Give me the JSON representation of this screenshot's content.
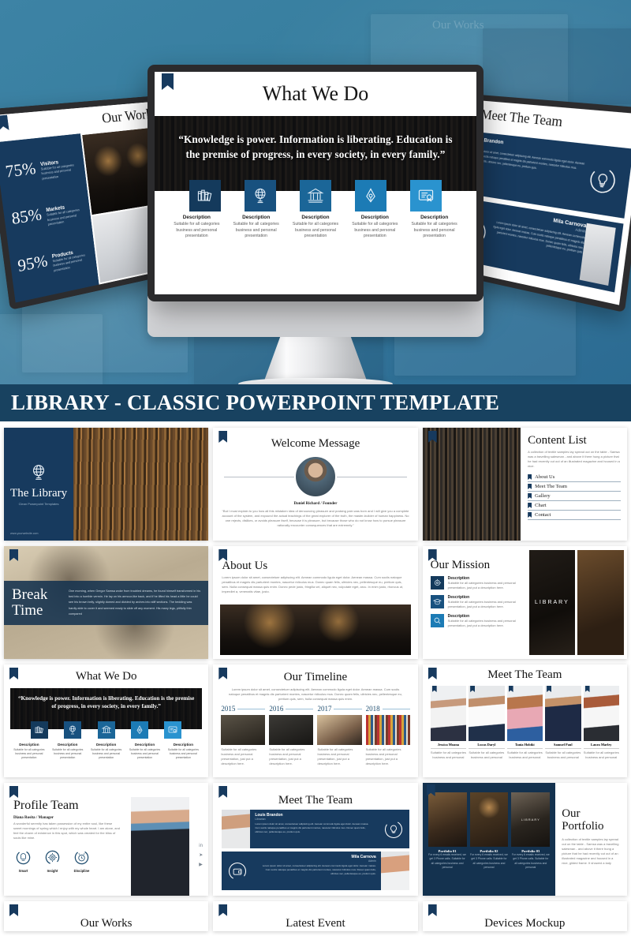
{
  "banner": {
    "title": "LIBRARY - CLASSIC POWERPOINT TEMPLATE",
    "bg_color": "#184260"
  },
  "hero": {
    "background_color": "#35789c",
    "center_monitor": {
      "slide_title": "What We Do",
      "quote": "“Knowledge is power. Information is liberating. Education is the premise of progress, in every society, in every family.”",
      "features": [
        {
          "icon": "books-icon",
          "title": "Description",
          "desc": "Suitable for all categories business and personal presentation",
          "color": "#143a5c"
        },
        {
          "icon": "globe-icon",
          "title": "Description",
          "desc": "Suitable for all categories business and personal presentation",
          "color": "#18517f"
        },
        {
          "icon": "bank-icon",
          "title": "Description",
          "desc": "Suitable for all categories business and personal presentation",
          "color": "#1b6698"
        },
        {
          "icon": "pen-nib-icon",
          "title": "Description",
          "desc": "Suitable for all categories business and personal presentation",
          "color": "#1c7bb5"
        },
        {
          "icon": "certificate-icon",
          "title": "Description",
          "desc": "Suitable for all categories business and personal presentation",
          "color": "#2a93cf"
        }
      ]
    },
    "left_monitor": {
      "slide_title": "Our Works",
      "stats": [
        {
          "value": "75%",
          "label": "Visitors",
          "desc": "Suitable for all categories business and personal presentation"
        },
        {
          "value": "85%",
          "label": "Markets",
          "desc": "Suitable for all categories business and personal presentation"
        },
        {
          "value": "95%",
          "label": "Products",
          "desc": "Suitable for all categories business and personal presentation"
        }
      ]
    },
    "right_monitor": {
      "slide_title": "Meet The Team",
      "members": [
        {
          "name": "Louis Brandon",
          "role": "Librarian",
          "desc": "Lorem ipsum dolor sit amet, consectetuer adipiscing elit. Aenean commodo ligula eget dolor. Aenean massa. Cum sociis natoque penatibus et magnis dis parturient montes, nascetur ridiculus mus. Donec quam felis, ultricies nec, pellentesque eu, pretium quis.",
          "icon": "lightbulb-icon"
        },
        {
          "name": "Mila Carnova",
          "role": "Admin",
          "desc": "Lorem ipsum dolor sit amet, consectetuer adipiscing elit. Aenean commodo ligula eget dolor. Aenean massa. Cum sociis natoque penatibus et magnis dis parturient montes, nascetur ridiculus mus. Donec quam felis, ultricies nec, pellentesque eu, pretium quis.",
          "icon": "wallet-icon"
        }
      ]
    }
  },
  "slides": [
    {
      "id": "cover",
      "title": "The Library",
      "subtitle": "Clean Powerpoint Templates",
      "website": "www.yourwebsite.com",
      "icon": "globe-icon"
    },
    {
      "id": "welcome",
      "title": "Welcome Message",
      "person": "Daniel Richard / Founder",
      "body": "“But I must explain to you how all this mistaken idea of denouncing pleasure and praising pain was born and I will give you a complete account of the system, and expound the actual teachings of the great explorer of the truth, the master-builder of human happiness. No one rejects, dislikes, or avoids pleasure itself, because it is pleasure, but because those who do not know how to pursue pleasure rationally encounter consequences that are extremely.”"
    },
    {
      "id": "content-list",
      "title": "Content List",
      "body": "A collection of textile samples lay spread out on the table - Samsa was a travelling salesman - and above it there hung a picture that he had recently cut out of an illustrated magazine and housed in a nice.",
      "items": [
        "About Us",
        "Meet The Team",
        "Gallery",
        "Chart",
        "Contact"
      ]
    },
    {
      "id": "break-time",
      "title": "Break Time",
      "body": "One morning, when Gregor Samsa woke from troubled dreams, he found himself transformed in his bed into a horrible vermin. He lay on his armour-like back, and if he lifted his head a little he could see his brown belly, slightly domed and divided by arches into stiff sections. The bedding was hardly able to cover it and seemed ready to slide off any moment. His many legs, pitifully thin compared"
    },
    {
      "id": "about-us",
      "title": "About Us",
      "body": "Lorem ipsum dolor sit amet, consectetuer adipiscing elit. Aenean commodo ligula eget dolor. Aenean massa. Cum sociis natoque penatibus et magnis dis parturient montes, nascetur ridiculus mus. Donec quam felis, ultricies nec, pellentesque eu, pretium quis, sem. Nulla consequat massa quis enim. Donec pede justo, fringilla vel, aliquet nec, vulputate eget, arcu. In enim justo, rhoncus ut, imperdiet a, venenatis vitae, justo."
    },
    {
      "id": "our-mission",
      "title": "Our Mission",
      "image_label": "LIBRARY",
      "items": [
        {
          "icon": "target-icon",
          "title": "Description",
          "desc": "Suitable for all categories business and personal presentation, just put a description here."
        },
        {
          "icon": "graduation-cap-icon",
          "title": "Description",
          "desc": "Suitable for all categories business and personal presentation, just put a description here."
        },
        {
          "icon": "magnifier-icon",
          "title": "Description",
          "desc": "Suitable for all categories business and personal presentation, just put a description here."
        }
      ]
    },
    {
      "id": "what-we-do",
      "title": "What We Do",
      "quote": "“Knowledge is power. Information is liberating. Education is the premise of progress, in every society, in every family.”",
      "features": [
        {
          "icon": "books-icon",
          "title": "Description",
          "desc": "Suitable for all categories business and personal presentation",
          "color": "#143a5c"
        },
        {
          "icon": "globe-icon",
          "title": "Description",
          "desc": "Suitable for all categories business and personal presentation",
          "color": "#18517f"
        },
        {
          "icon": "bank-icon",
          "title": "Description",
          "desc": "Suitable for all categories business and personal presentation",
          "color": "#1b6698"
        },
        {
          "icon": "pen-nib-icon",
          "title": "Description",
          "desc": "Suitable for all categories business and personal presentation",
          "color": "#1c7bb5"
        },
        {
          "icon": "certificate-icon",
          "title": "Description",
          "desc": "Suitable for all categories business and personal presentation",
          "color": "#2a93cf"
        }
      ]
    },
    {
      "id": "our-timeline",
      "title": "Our Timeline",
      "body": "Lorem ipsum dolor sit amet, consectetuer adipiscing elit. Aenean commodo ligula eget dolor. Aenean massa. Cum sociis natoque penatibus et magnis dis parturient montes, nascetur ridiculus mus. Donec quam felis, ultricies nec, pellentesque eu, pretium quis, sem, hulla consequat massa quis enim.",
      "entries": [
        {
          "year": "2015",
          "desc": "Suitable for all categories business and personal presentation, just put a description here."
        },
        {
          "year": "2016",
          "desc": "Suitable for all categories business and personal presentation, just put a description here."
        },
        {
          "year": "2017",
          "desc": "Suitable for all categories business and personal presentation, just put a description here."
        },
        {
          "year": "2018",
          "desc": "Suitable for all categories business and personal presentation, just put a description here."
        }
      ]
    },
    {
      "id": "meet-the-team-grid",
      "title": "Meet The Team",
      "members": [
        {
          "name": "Jessica Moana",
          "desc": "Suitable for all categories business and personal"
        },
        {
          "name": "Lucas Daryl",
          "desc": "Suitable for all categories business and personal"
        },
        {
          "name": "Tania Hobiki",
          "desc": "Suitable for all categories business and personal"
        },
        {
          "name": "Samuel Paul",
          "desc": "Suitable for all categories business and personal"
        },
        {
          "name": "Laura Marley",
          "desc": "Suitable for all categories business and personal"
        }
      ]
    },
    {
      "id": "profile-team",
      "title": "Profile Team",
      "person": "Diana Rosita / Manager",
      "body": "A wonderful serenity has taken possession of my entire soul, like these sweet mornings of spring which I enjoy with my whole heart. I am alone, and feel the charm of existence in this spot, which was created for the bliss of souls like mine.",
      "traits": [
        {
          "icon": "brain-icon",
          "label": "Smart"
        },
        {
          "icon": "gear-icon",
          "label": "Insight"
        },
        {
          "icon": "clock-icon",
          "label": "Discipline"
        }
      ],
      "social": [
        "linkedin-icon",
        "twitter-icon",
        "youtube-icon"
      ]
    },
    {
      "id": "meet-the-team-cards",
      "title": "Meet The Team",
      "members": [
        {
          "name": "Louis Brandon",
          "role": "Librarian",
          "desc": "Lorem ipsum dolor sit amet, consectetuer adipiscing elit. Aenean commodo ligula eget dolor. Aenean massa. Cum sociis natoque penatibus et magnis dis parturient montes, nascetur ridiculus mus. Donec quam felis, ultricies nec, pellentesque eu, pretium quis.",
          "icon": "lightbulb-icon"
        },
        {
          "name": "Mila Carnova",
          "role": "Admin",
          "desc": "Lorem ipsum dolor sit amet, consectetuer adipiscing elit. Aenean commodo ligula eget dolor. Aenean massa. Cum sociis natoque penatibus et magnis dis parturient montes, nascetur ridiculus mus. Donec quam felis, ultricies nec, pellentesque eu, pretium quis.",
          "icon": "wallet-icon"
        }
      ]
    },
    {
      "id": "our-portfolio",
      "title_line1": "Our",
      "title_line2": "Portfolio",
      "body": "A collection of textile samples lay spread out on the table - Samsa was a travelling salesman - and above it there hung a picture that he had recently cut out of an illustrated magazine and housed in a nice, gilded frame. It showed a lady",
      "items": [
        {
          "name": "Portfolio 01",
          "desc": "For every 6 emails received, we get 3 Phone calls. Suitable for all categories business and personal"
        },
        {
          "name": "Portfolio 02",
          "desc": "For every 6 emails received, we get 3 Phone calls. Suitable for all categories business and personal"
        },
        {
          "name": "Portfolio 03",
          "desc": "For every 6 emails received, we get 3 Phone calls. Suitable for all categories business and personal"
        }
      ]
    },
    {
      "id": "our-works-bottom",
      "title": "Our Works"
    },
    {
      "id": "latest-event-bottom",
      "title": "Latest Event"
    },
    {
      "id": "devices-mockup-bottom",
      "title": "Devices Mockup"
    }
  ]
}
